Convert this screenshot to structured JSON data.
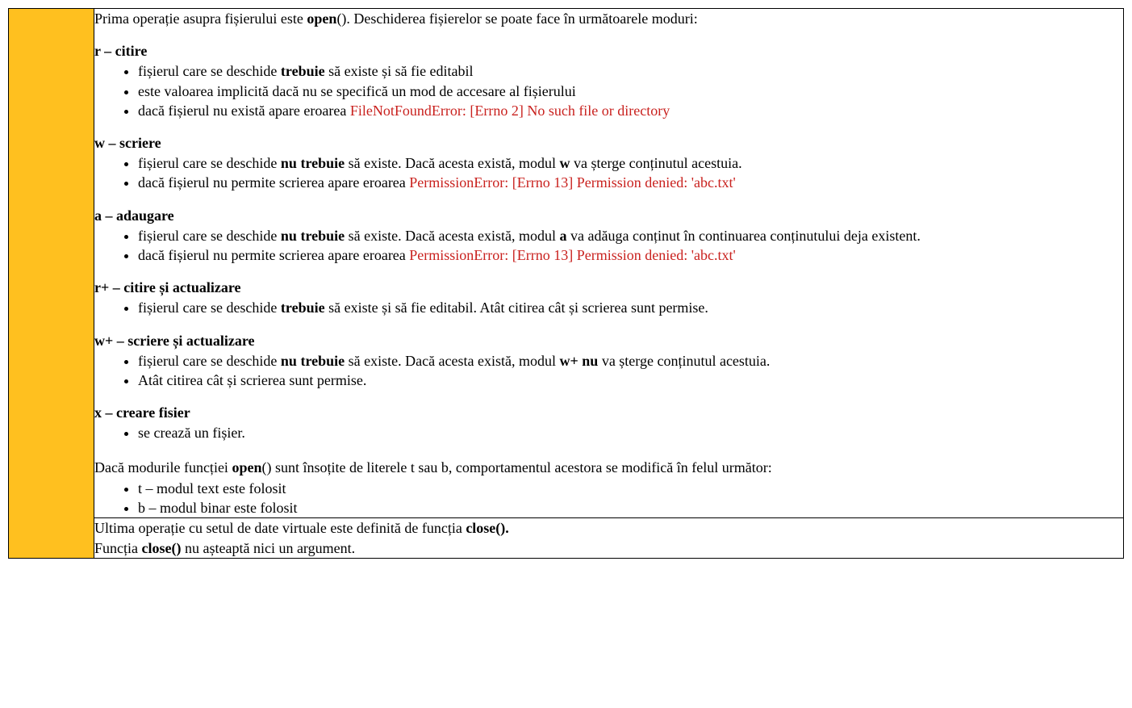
{
  "intro": {
    "t1": "Prima operație asupra fișierului este ",
    "open": "open",
    "t2": "(). Deschiderea fișierelor se poate face în următoarele moduri:"
  },
  "modes": {
    "r": {
      "head": "r – citire",
      "b1a": "fișierul care se deschide ",
      "b1b": "trebuie",
      "b1c": " să existe și să fie editabil",
      "b2": "este valoarea implicită dacă nu se specifică un mod de accesare al fișierului",
      "b3a": "dacă fișierul nu există apare eroarea ",
      "b3err": "FileNotFoundError: [Errno 2] No such file or directory"
    },
    "w": {
      "head": "w – scriere",
      "b1a": "fișierul care se deschide ",
      "b1b": "nu trebuie",
      "b1c": " să existe. Dacă acesta există, modul ",
      "b1d": "w",
      "b1e": " va șterge conținutul acestuia.",
      "b2a": "dacă fișierul nu permite scrierea apare eroarea ",
      "b2err": "PermissionError: [Errno 13] Permission denied: 'abc.txt'"
    },
    "a": {
      "head": "a – adaugare",
      "b1a": "fișierul care se deschide ",
      "b1b": "nu trebuie",
      "b1c": " să existe. Dacă acesta există, modul ",
      "b1d": "a",
      "b1e": " va adăuga conținut în continuarea conținutului deja existent.",
      "b2a": "dacă fișierul nu permite scrierea apare eroarea ",
      "b2err": "PermissionError: [Errno 13] Permission denied: 'abc.txt'"
    },
    "rplus": {
      "head": "r+ – citire și actualizare",
      "b1a": "fișierul care se deschide ",
      "b1b": "trebuie",
      "b1c": " să existe și să fie editabil. Atât citirea cât și scrierea sunt permise."
    },
    "wplus": {
      "head": "w+ – scriere și actualizare",
      "b1a": "fișierul care se deschide ",
      "b1b": "nu trebuie",
      "b1c": " să existe. Dacă acesta există, modul ",
      "b1d": "w+",
      "b1e": " ",
      "b1f": "nu",
      "b1g": " va șterge conținutul acestuia.",
      "b2": "Atât citirea cât și scrierea sunt permise."
    },
    "x": {
      "head": "x – creare fisier",
      "b1": "se crează un fișier."
    }
  },
  "tb": {
    "intro1": "Dacă modurile funcției ",
    "open": "open",
    "intro2": "() sunt însoțite de literele t sau b, comportamentul acestora se modifică în felul următor:",
    "b1": "t – modul text este folosit",
    "b2": "b – modul binar este folosit"
  },
  "footer": {
    "l1a": "Ultima operație cu setul de date virtuale este definită de funcția ",
    "l1b": "close().",
    "l2a": "Funcția ",
    "l2b": "close()",
    "l2c": " nu așteaptă nici un argument."
  }
}
